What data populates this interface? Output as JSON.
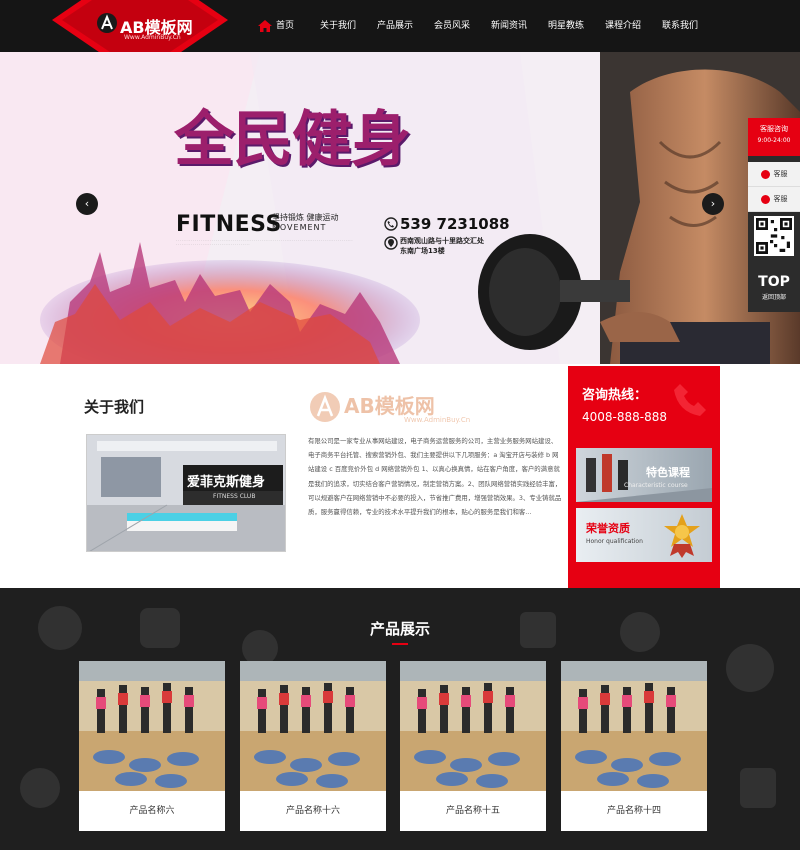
{
  "header": {
    "logo": {
      "text": "AB模板网",
      "sub": "Www.AdminBuy.Cn"
    },
    "nav": [
      {
        "label": "首页",
        "icon": "home-icon"
      },
      {
        "label": "关于我们"
      },
      {
        "label": "产品展示"
      },
      {
        "label": "会员风采"
      },
      {
        "label": "新闻资讯"
      },
      {
        "label": "明星教练"
      },
      {
        "label": "课程介绍"
      },
      {
        "label": "联系我们"
      }
    ]
  },
  "banner": {
    "headline": "全民健身",
    "fitness": "FITNESS",
    "movement": "MOVEMENT",
    "slogan": "坚持锻炼 健康运动",
    "phone": "539 7231088",
    "address_line1": "西南观山路与十里路交汇处",
    "address_line2": "东南广场13楼"
  },
  "float_panel": {
    "title": "客服咨询",
    "hours": "9:00-24:00",
    "items": [
      {
        "label": "客服"
      },
      {
        "label": "客服"
      }
    ],
    "top_label": "TOP",
    "top_sub": "返回顶部"
  },
  "about": {
    "title": "关于我们",
    "gym_sign": "爱菲克斯健身",
    "gym_sign_en": "FITNESS CLUB",
    "text": "有限公司是一家专业从事网站建设，电子商务运营服务的公司，主营业务服务网站建设、电子商务平台托管、搜索营销外包、我们主要提供以下几项服务：a 淘宝开店与装修 b 网站建设 c 百度竞价外包 d 网络营销外包 1、以真心换真情，站在客户角度，客户的满意就是我们的追求，切实结合客户营销情况，制定营销方案。2、团队网络营销实践经验丰富，可以规避客户在网络营销中不必要的投入，节省推广费用，增强营销效果。3、专业铸就品质，服务赢得信赖，专业的技术水平提升我们的根本，贴心的服务是我们和客...",
    "watermark": "AB模板网",
    "watermark_sub": "Www.AdminBuy.Cn"
  },
  "hotline": {
    "title": "咨询热线：",
    "number": "4008-888-888",
    "cards": [
      {
        "label": "特色课程",
        "sub": "Characteristic course"
      },
      {
        "label": "荣誉资质",
        "sub": "Honor qualification"
      }
    ]
  },
  "products": {
    "title": "产品展示",
    "items": [
      {
        "name": "产品名称六"
      },
      {
        "name": "产品名称十六"
      },
      {
        "name": "产品名称十五"
      },
      {
        "name": "产品名称十四"
      }
    ]
  },
  "colors": {
    "accent": "#e60012",
    "header_bg": "#151515",
    "dark_bg": "#1f1f1f"
  }
}
